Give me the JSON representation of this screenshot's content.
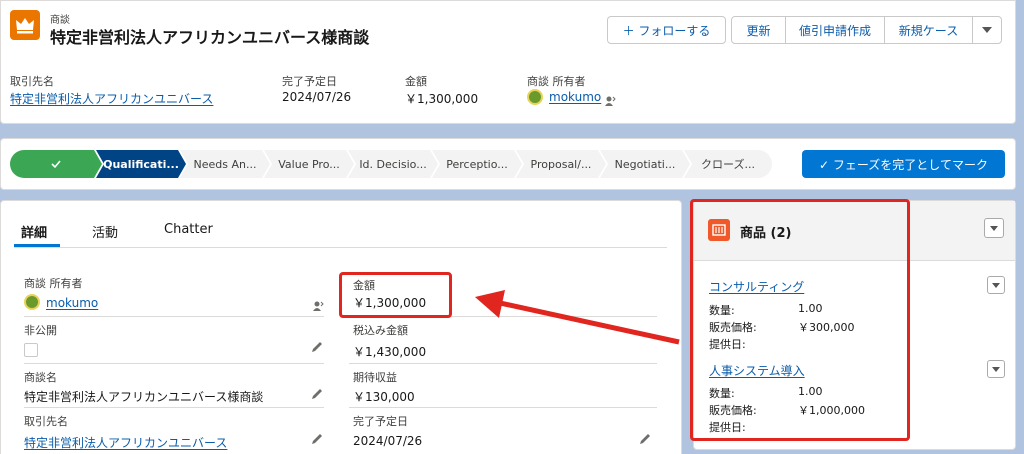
{
  "header": {
    "object_label": "商談",
    "record_name": "特定非営利法人アフリカンユニバース様商談",
    "buttons": {
      "follow": "＋ フォローする",
      "refresh": "更新",
      "discount": "値引申請作成",
      "new_case": "新規ケース"
    }
  },
  "highlights": [
    {
      "label": "取引先名",
      "value": "特定非営利法人アフリカンユニバース"
    },
    {
      "label": "完了予定日",
      "value": "2024/07/26"
    },
    {
      "label": "金額",
      "value": "￥1,300,000"
    },
    {
      "label": "商談 所有者",
      "value": "mokumo"
    }
  ],
  "path": {
    "stages": [
      "Qualificati...",
      "Needs An...",
      "Value Pro...",
      "Id. Decisio...",
      "Perceptio...",
      "Proposal/...",
      "Negotiati...",
      "クローズ..."
    ],
    "complete_button": "✓ フェーズを完了としてマーク"
  },
  "tabs": [
    "詳細",
    "活動",
    "Chatter"
  ],
  "details": {
    "left": [
      {
        "label": "商談 所有者",
        "value": "mokumo"
      },
      {
        "label": "非公開",
        "value": ""
      },
      {
        "label": "商談名",
        "value": "特定非営利法人アフリカンユニバース様商談"
      },
      {
        "label": "取引先名",
        "value": "特定非営利法人アフリカンユニバース"
      }
    ],
    "right": [
      {
        "label": "金額",
        "value": "￥1,300,000"
      },
      {
        "label": "税込み金額",
        "value": "￥1,430,000"
      },
      {
        "label": "期待収益",
        "value": "￥130,000"
      },
      {
        "label": "完了予定日",
        "value": "2024/07/26"
      }
    ]
  },
  "products": {
    "title": "商品 (2)",
    "items": [
      {
        "name": "コンサルティング",
        "qty_label": "数量:",
        "qty": "1.00",
        "price_label": "販売価格:",
        "price": "￥300,000",
        "date_label": "提供日:"
      },
      {
        "name": "人事システム導入",
        "qty_label": "数量:",
        "qty": "1.00",
        "price_label": "販売価格:",
        "price": "￥1,000,000",
        "date_label": "提供日:"
      }
    ]
  },
  "colors": {
    "brand": "#0b5cab",
    "complete": "#3ba755",
    "current": "#014486",
    "header_icon": "#ea7600",
    "product_icon": "#f05a2a",
    "annotation": "#e0261f"
  }
}
